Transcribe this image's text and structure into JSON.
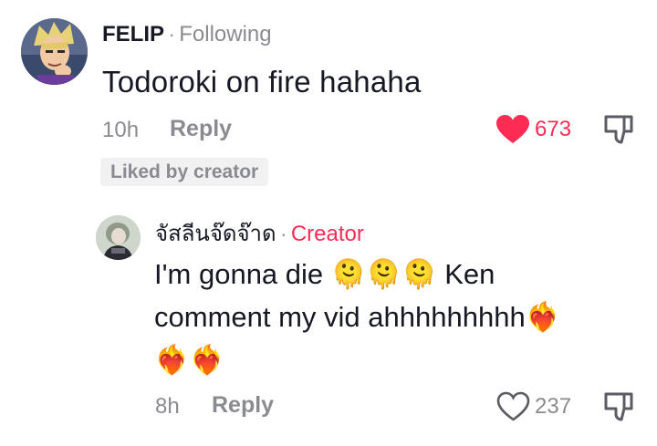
{
  "comment": {
    "username": "FELIP",
    "separator": "·",
    "follow_status": "Following",
    "text": "Todoroki on fire hahaha",
    "time": "10h",
    "reply_label": "Reply",
    "like_count": "673",
    "liked": true,
    "liked_by": "Liked by creator",
    "avatar_icon": "anime-character-avatar"
  },
  "reply": {
    "username": "จัสลีนจ๊ดจ๊าด",
    "separator": "·",
    "badge": "Creator",
    "text_part1": "I'm gonna die",
    "text_part2": "Ken",
    "text_line2": "comment my vid ahhhhhhhhh",
    "emoji_melting": "🫠",
    "emoji_heart_fire": "❤️‍🔥",
    "time": "8h",
    "reply_label": "Reply",
    "like_count": "237",
    "liked": false,
    "avatar_icon": "person-avatar"
  },
  "colors": {
    "accent": "#fe2c55",
    "muted": "#8a8b91",
    "text": "#161823",
    "chip_bg": "#f1f1f2"
  }
}
